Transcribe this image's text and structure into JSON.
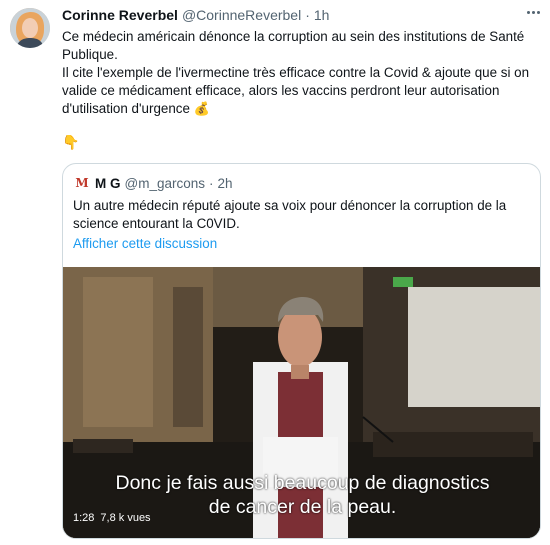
{
  "tweet": {
    "name": "Corinne Reverbel",
    "handle": "@CorinneReverbel",
    "separator": "·",
    "time": "1h",
    "text_lines": [
      "Ce médecin américain dénonce la corruption au sein des institutions de Santé",
      "Publique.",
      "Il cite l'exemple de l'ivermectine très efficace contre la Covid & ajoute  que si on",
      "valide ce médicament  efficace, alors les vaccins perdront leur autorisation",
      "d'utilisation d'urgence"
    ],
    "emoji_after_text": "💰",
    "pointing_emoji": "👇"
  },
  "quoted": {
    "avatar_letter": "M",
    "name": "M G",
    "handle": "@m_garcons",
    "separator": "·",
    "time": "2h",
    "text_lines": [
      "Un autre médecin réputé ajoute sa voix pour dénoncer la corruption de la",
      "science entourant la C0VID."
    ],
    "show_thread": "Afficher cette discussion",
    "video": {
      "caption_lines": [
        "Donc je fais aussi beaucoup de diagnostics",
        "de cancer de la peau."
      ],
      "duration": "1:28",
      "views": "7,8 k vues"
    }
  },
  "colors": {
    "link": "#1d9bf0",
    "secondary_text": "#536471",
    "border": "#cfd9de"
  },
  "icons": {
    "more": "more-dots-icon",
    "money_bag": "money-bag-emoji",
    "pointing_down": "pointing-down-emoji"
  }
}
